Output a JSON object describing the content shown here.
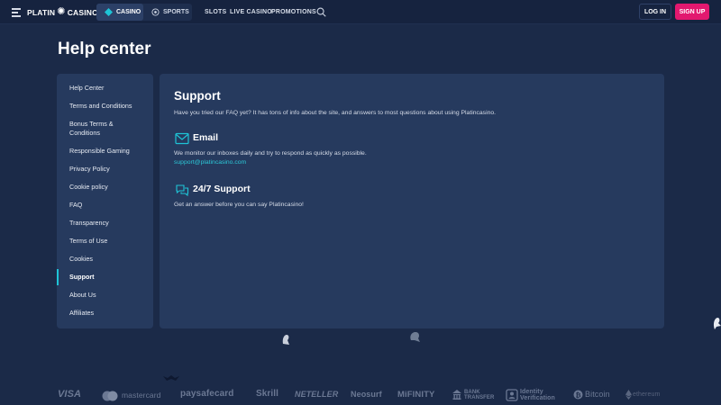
{
  "header": {
    "logo": {
      "left": "PLATIN",
      "right": "CASINO"
    },
    "tabs": [
      {
        "label": "CASINO",
        "active": true
      },
      {
        "label": "SPORTS",
        "active": false
      }
    ],
    "nav": [
      "SLOTS",
      "LIVE CASINO",
      "PROMOTIONS"
    ],
    "login_label": "LOG IN",
    "signup_label": "SIGN UP"
  },
  "page": {
    "title": "Help center"
  },
  "sidebar": {
    "items": [
      {
        "label": "Help Center"
      },
      {
        "label": "Terms and Conditions"
      },
      {
        "label": "Bonus Terms & Conditions"
      },
      {
        "label": "Responsible Gaming"
      },
      {
        "label": "Privacy Policy"
      },
      {
        "label": "Cookie policy"
      },
      {
        "label": "FAQ"
      },
      {
        "label": "Transparency"
      },
      {
        "label": "Terms of Use"
      },
      {
        "label": "Cookies"
      },
      {
        "label": "Support",
        "active": true
      },
      {
        "label": "About Us"
      },
      {
        "label": "Affiliates"
      }
    ]
  },
  "support": {
    "title": "Support",
    "intro": "Have you tried our FAQ yet? It has tons of info about the site, and answers to most questions about using Platincasino.",
    "email": {
      "title": "Email",
      "text": "We monitor our inboxes daily and try to respond as quickly as possible.",
      "address": "support@platincasino.com"
    },
    "live": {
      "title": "24/7 Support",
      "text": "Get an answer before you can say Platincasino!"
    }
  },
  "payments": [
    "VISA",
    "mastercard",
    "paysafecard",
    "Skrill",
    "NETELLER",
    "Neosurf",
    "MiFINITY",
    "BANK TRANSFER",
    "Identity Verification",
    "Bitcoin",
    "ethereum"
  ],
  "colors": {
    "bg": "#1b2a48",
    "card": "#263a5e",
    "accent": "#1ec4d6",
    "signup": "#e2186f"
  }
}
